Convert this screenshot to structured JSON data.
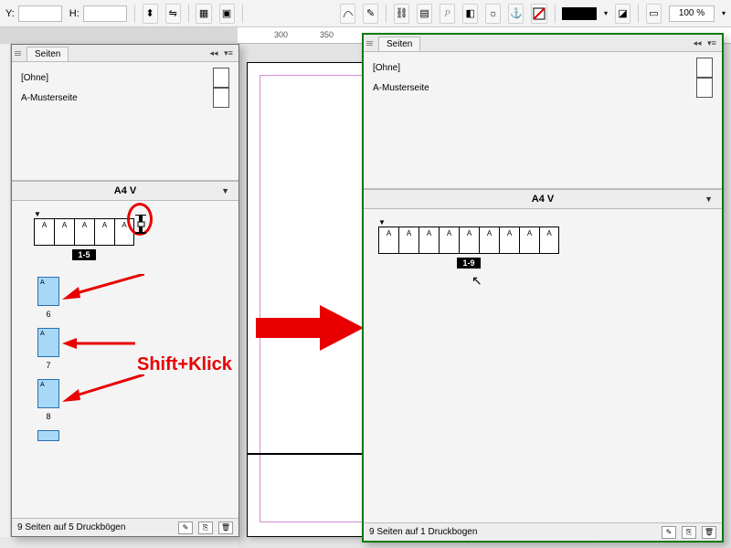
{
  "topbar": {
    "y_label": "Y:",
    "h_label": "H:",
    "zoom": "100 %",
    "link_icon": "⛓",
    "dropdown_icon": "▾"
  },
  "ruler": {
    "m300": "300",
    "m350": "350"
  },
  "panel_left": {
    "tab": "Seiten",
    "masters": {
      "none": "[Ohne]",
      "a": "A-Musterseite"
    },
    "size": "A4 V",
    "spread1": {
      "labels": [
        "A",
        "A",
        "A",
        "A",
        "A"
      ],
      "range": "1-5"
    },
    "singles": [
      {
        "letter": "A",
        "num": "6"
      },
      {
        "letter": "A",
        "num": "7"
      },
      {
        "letter": "A",
        "num": "8"
      }
    ],
    "status": "9 Seiten auf 5 Druckbögen"
  },
  "panel_right": {
    "tab": "Seiten",
    "masters": {
      "none": "[Ohne]",
      "a": "A-Musterseite"
    },
    "size": "A4 V",
    "spread1": {
      "labels": [
        "A",
        "A",
        "A",
        "A",
        "A",
        "A",
        "A",
        "A",
        "A"
      ],
      "range": "1-9"
    },
    "status": "9 Seiten auf 1 Druckbogen"
  },
  "annotation": {
    "text": "Shift+Klick"
  }
}
